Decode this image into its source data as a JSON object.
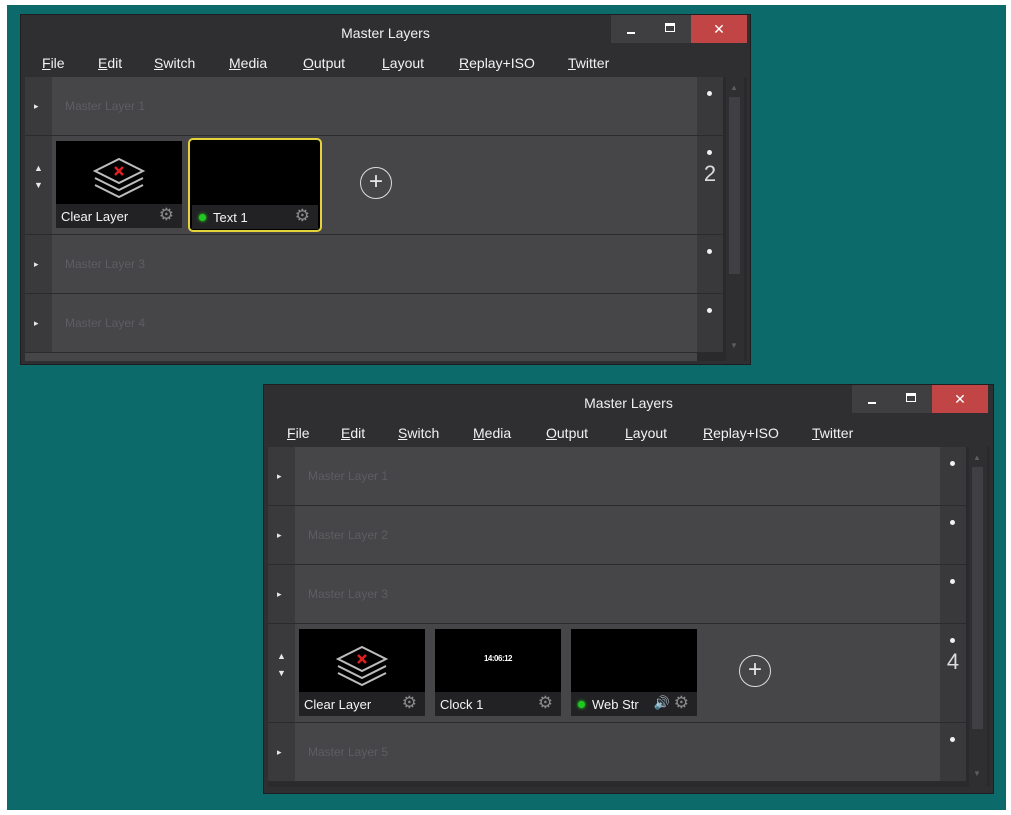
{
  "window_title": "Master Layers",
  "window_buttons": {
    "minimize": "minimize-icon",
    "maximize": "maximize-icon",
    "close": "✕"
  },
  "menu": [
    {
      "label": "File",
      "accel": "F",
      "rest": "ile"
    },
    {
      "label": "Edit",
      "accel": "E",
      "rest": "dit"
    },
    {
      "label": "Switch",
      "accel": "S",
      "rest": "witch"
    },
    {
      "label": "Media",
      "accel": "M",
      "rest": "edia"
    },
    {
      "label": "Output",
      "accel": "O",
      "rest": "utput"
    },
    {
      "label": "Layout",
      "accel": "L",
      "rest": "ayout"
    },
    {
      "label": "Replay+ISO",
      "accel": "R",
      "rest": "eplay+ISO"
    },
    {
      "label": "Twitter",
      "accel": "T",
      "rest": "witter"
    }
  ],
  "window1": {
    "layers": {
      "layer1": "Master Layer 1",
      "layer3": "Master Layer 3",
      "layer4": "Master Layer 4"
    },
    "expanded_number": "2",
    "cards": {
      "clear": "Clear Layer",
      "text": "Text 1"
    }
  },
  "window2": {
    "layers": {
      "layer1": "Master Layer 1",
      "layer2": "Master Layer 2",
      "layer3": "Master Layer 3",
      "layer5": "Master Layer 5"
    },
    "expanded_number": "4",
    "cards": {
      "clear": "Clear Layer",
      "clock": "Clock 1",
      "clock_time": "14:06:12",
      "web": "Web Str"
    }
  },
  "colors": {
    "desktop": "#0c6a6a",
    "selection": "#e6d33a",
    "active_indicator": "#22c722",
    "close_button": "#c14545",
    "clear_x": "#e02020"
  },
  "icons": {
    "expand": "▸",
    "up": "▲",
    "down": "▼",
    "gear": "⚙",
    "speaker": "🔊",
    "add": "+"
  }
}
